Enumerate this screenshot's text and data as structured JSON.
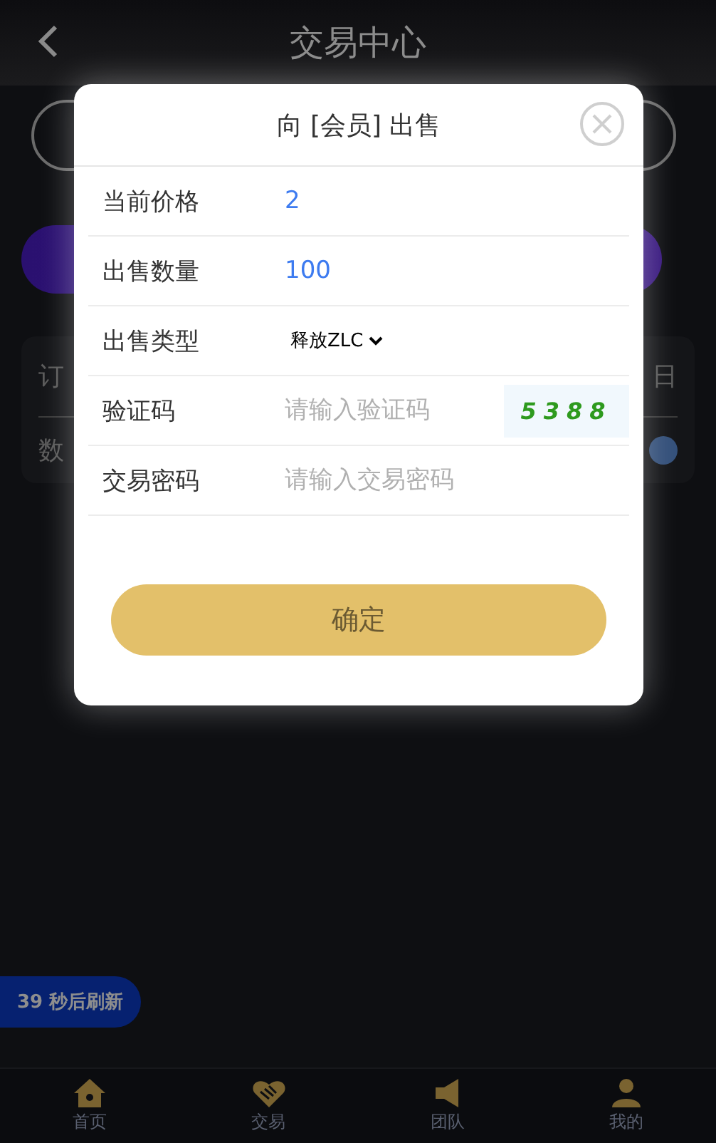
{
  "header": {
    "title": "交易中心"
  },
  "card": {
    "row_1": "订",
    "row_1_end": "日",
    "row_2": "数"
  },
  "modal": {
    "title": "向 [会员] 出售",
    "fields": [
      {
        "kind": "value",
        "label": "当前价格",
        "value": "2"
      },
      {
        "kind": "value",
        "label": "出售数量",
        "value": "100"
      },
      {
        "kind": "select",
        "label": "出售类型",
        "value": "释放ZLC"
      },
      {
        "kind": "captcha",
        "label": "验证码",
        "placeholder": "请输入验证码",
        "captcha": "5388"
      },
      {
        "kind": "input",
        "label": "交易密码",
        "placeholder": "请输入交易密码"
      }
    ],
    "confirm": "确定"
  },
  "refresh_badge": "39 秒后刷新",
  "nav": [
    {
      "label": "首页"
    },
    {
      "label": "交易"
    },
    {
      "label": "团队"
    },
    {
      "label": "我的"
    }
  ]
}
